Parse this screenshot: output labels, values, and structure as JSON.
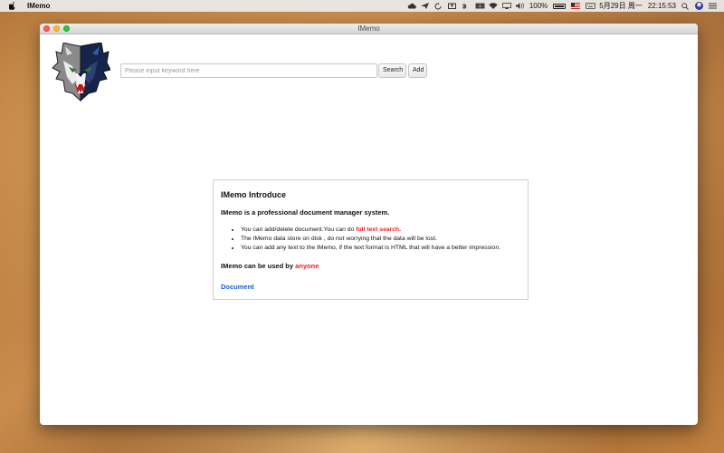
{
  "menubar": {
    "app_name": "IMemo",
    "battery": "100%",
    "date": "5月29日 周一",
    "time": "22:15:53"
  },
  "window": {
    "title": "IMemo"
  },
  "toolbar": {
    "search_placeholder": "Please input keyword here",
    "search_label": "Search",
    "add_label": "Add"
  },
  "intro": {
    "title": "IMemo Introduce",
    "subtitle": "IMemo is a professional document manager system.",
    "items": [
      {
        "text": "You can add/delete document.You can do ",
        "highlight": "full text search."
      },
      {
        "text": "The IMemo data store on disk , do not worrying that the data will be lost.",
        "highlight": ""
      },
      {
        "text": "You can add any text to the IMemo, if the text format is HTML that will have a better impression.",
        "highlight": ""
      }
    ],
    "usage_prefix": "IMemo can be used by ",
    "usage_highlight": "anyone",
    "link_label": "Document"
  },
  "colors": {
    "highlight": "#f02020",
    "link": "#1a5ed0"
  }
}
